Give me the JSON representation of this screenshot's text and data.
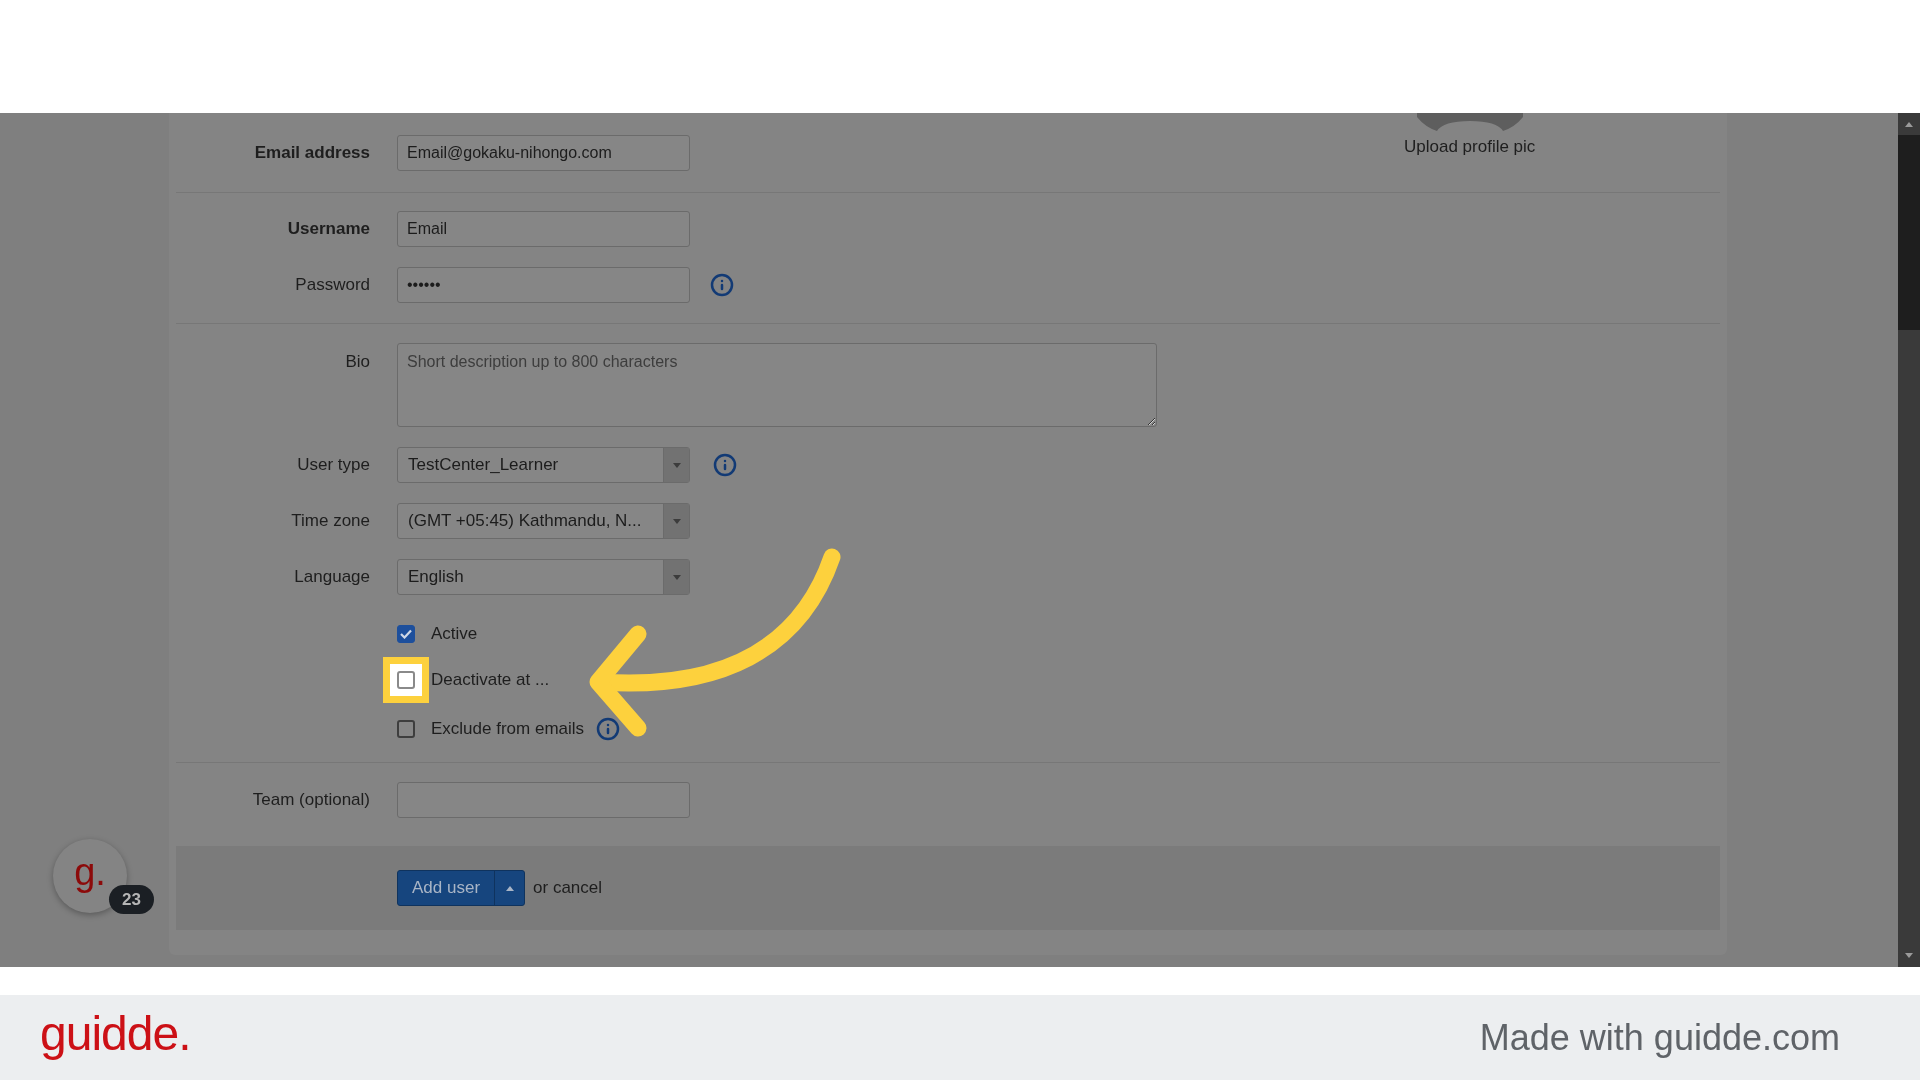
{
  "profile_pic": {
    "label": "Upload profile pic"
  },
  "sections": [
    {
      "fields": [
        {
          "kind": "text",
          "label": "Email address",
          "required": true,
          "value": "Email@gokaku-nihongo.com"
        }
      ]
    },
    {
      "fields": [
        {
          "kind": "text",
          "label": "Username",
          "required": true,
          "value": "Email"
        },
        {
          "kind": "password",
          "label": "Password",
          "required": false,
          "value": "••••••",
          "info": true
        }
      ]
    },
    {
      "fields": [
        {
          "kind": "textarea",
          "label": "Bio",
          "required": false,
          "placeholder": "Short description up to 800 characters"
        },
        {
          "kind": "select",
          "label": "User type",
          "required": false,
          "value": "TestCenter_Learner",
          "info": true
        },
        {
          "kind": "select",
          "label": "Time zone",
          "required": false,
          "value": "(GMT +05:45) Kathmandu, N..."
        },
        {
          "kind": "select",
          "label": "Language",
          "required": false,
          "value": "English"
        },
        {
          "kind": "checkbox",
          "label": "Active",
          "checked": true,
          "highlighted": false
        },
        {
          "kind": "checkbox",
          "label": "Deactivate at ...",
          "checked": false,
          "highlighted": true
        },
        {
          "kind": "checkbox",
          "label": "Exclude from emails",
          "checked": false,
          "highlighted": false,
          "info": true
        }
      ]
    },
    {
      "fields": [
        {
          "kind": "text",
          "label": "Team (optional)",
          "required": false
        }
      ]
    }
  ],
  "actions": {
    "submit": "Add user",
    "cancel": "or cancel"
  },
  "launcher": {
    "letter": "g.",
    "badge": "23"
  },
  "footer": {
    "logo": "guidde.",
    "credit": "Made with guidde.com"
  }
}
